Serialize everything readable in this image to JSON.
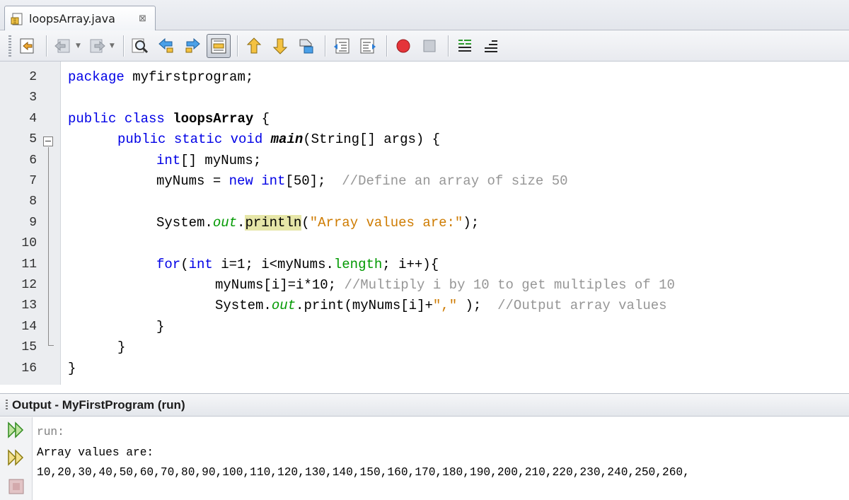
{
  "tab": {
    "title": "loopsArray.java",
    "close_glyph": "⊠"
  },
  "toolbar": {
    "buttons": [
      "last-edit-icon",
      "back-icon",
      "forward-icon",
      "find-selection-icon",
      "find-previous-icon",
      "find-next-icon",
      "toggle-highlight-icon",
      "previous-bookmark-icon",
      "next-bookmark-icon",
      "toggle-bookmark-icon",
      "shift-left-icon",
      "shift-right-icon",
      "start-macro-icon",
      "stop-macro-icon",
      "comment-icon",
      "uncomment-icon"
    ]
  },
  "editor": {
    "line_numbers": [
      "2",
      "3",
      "4",
      "5",
      "6",
      "7",
      "8",
      "9",
      "10",
      "11",
      "12",
      "13",
      "14",
      "15",
      "16"
    ],
    "code": {
      "l2a": "package",
      "l2b": " myfirstprogram;",
      "l4a": "public class",
      "l4b": " ",
      "l4c": "loopsArray",
      "l4d": " {",
      "l5a": "public static void",
      "l5b": " ",
      "l5c": "main",
      "l5d": "(String[] args) {",
      "l6a": "int",
      "l6b": "[] myNums;",
      "l7a": "myNums = ",
      "l7b": "new int",
      "l7c": "[50];  ",
      "l7d": "//Define an array of size 50",
      "l9a": "System.",
      "l9b": "out",
      "l9c": ".",
      "l9d": "println",
      "l9e": "(",
      "l9f": "\"Array values are:\"",
      "l9g": ");",
      "l11a": "for",
      "l11b": "(",
      "l11c": "int",
      "l11d": " i=1; i<myNums.",
      "l11e": "length",
      "l11f": "; i++){",
      "l12a": "myNums[i]=i*10; ",
      "l12b": "//Multiply i by 10 to get multiples of 10",
      "l13a": "System.",
      "l13b": "out",
      "l13c": ".print(myNums[i]+",
      "l13d": "\",\"",
      "l13e": " );  ",
      "l13f": "//Output array values",
      "l14a": "}",
      "l15a": "}",
      "l16a": "}"
    }
  },
  "output": {
    "title": "Output - MyFirstProgram (run)",
    "lines": [
      "run:",
      "Array values are:",
      "10,20,30,40,50,60,70,80,90,100,110,120,130,140,150,160,170,180,190,200,210,220,230,240,250,260,"
    ],
    "side_buttons": [
      "rerun-icon",
      "rerun-with-options-icon",
      "stop-icon"
    ]
  },
  "colors": {
    "keyword": "#0000e6",
    "comment": "#969696",
    "string": "#ce7b00",
    "field": "#009900",
    "highlight": "#e6e6a8"
  }
}
